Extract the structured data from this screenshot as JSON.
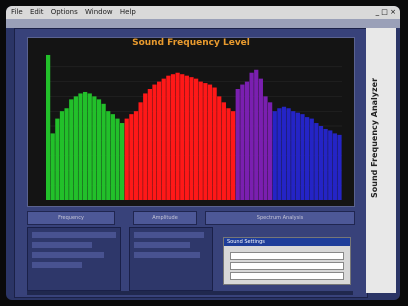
{
  "menubar": {
    "items": [
      "File",
      "Edit",
      "Options",
      "Window",
      "Help"
    ]
  },
  "window_controls": {
    "label": "_ □ ×"
  },
  "chart": {
    "title": "Sound Frequency Level"
  },
  "sidebar": {
    "vertical_text": "Sound Frequency Analyzer"
  },
  "tabs": [
    {
      "label": "Frequency"
    },
    {
      "label": "Amplitude"
    },
    {
      "label": "Spectrum Analysis"
    }
  ],
  "dialog": {
    "title": "Sound Settings"
  },
  "chart_data": {
    "type": "bar",
    "title": "Sound Frequency Level",
    "xlabel": "",
    "ylabel": "",
    "ylim": [
      0,
      100
    ],
    "series": [
      {
        "color": "#22c02a",
        "values": [
          98,
          45,
          55,
          60,
          62,
          68,
          70,
          72,
          73,
          72,
          70,
          68,
          65,
          60,
          58,
          55,
          52
        ]
      },
      {
        "color": "#ff1818",
        "values": [
          55,
          58,
          60,
          66,
          72,
          75,
          78,
          80,
          82,
          84,
          85,
          86,
          85,
          84,
          83,
          82,
          80,
          79,
          78,
          76,
          70,
          66,
          62,
          60
        ]
      },
      {
        "color": "#7a1fb0",
        "values": [
          75,
          78,
          80,
          86,
          88,
          82,
          70,
          66
        ]
      },
      {
        "color": "#2424c6",
        "values": [
          60,
          62,
          63,
          62,
          60,
          59,
          58,
          56,
          55,
          52,
          50,
          48,
          47,
          45,
          44
        ]
      }
    ],
    "grid": true
  }
}
